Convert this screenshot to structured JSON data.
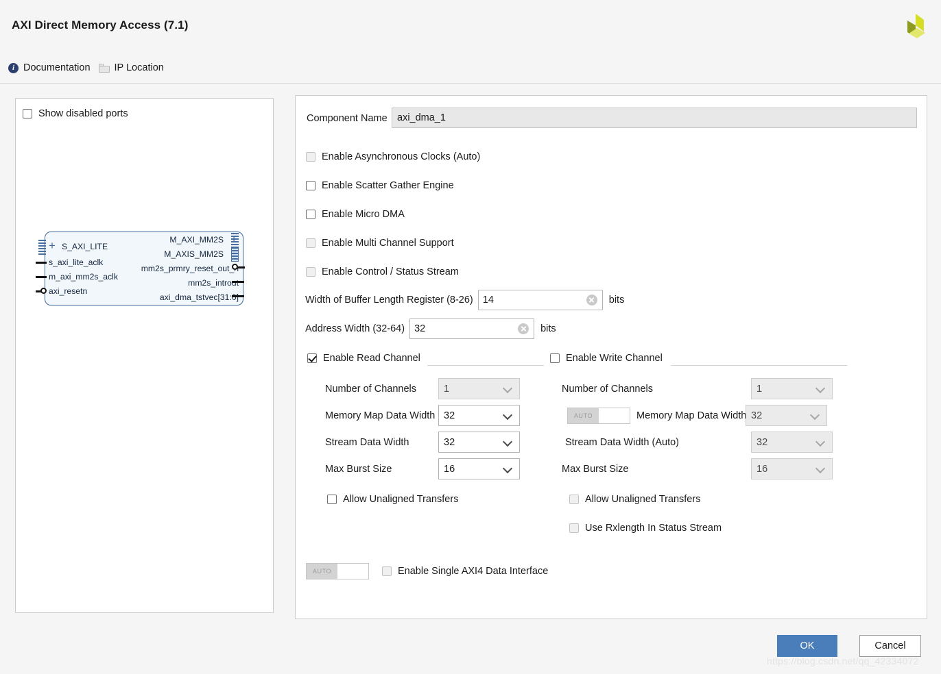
{
  "header": {
    "title": "AXI Direct Memory Access (7.1)",
    "links": [
      {
        "icon": "info-icon",
        "label": "Documentation"
      },
      {
        "icon": "folder-icon",
        "label": "IP Location"
      }
    ],
    "logo_name": "xilinx-logo"
  },
  "left_panel": {
    "show_disabled_ports": {
      "label": "Show disabled ports",
      "checked": false
    }
  },
  "diagram": {
    "left_ports": [
      "S_AXI_LITE",
      "s_axi_lite_aclk",
      "m_axi_mm2s_aclk",
      "axi_resetn"
    ],
    "right_ports": [
      "M_AXI_MM2S",
      "M_AXIS_MM2S",
      "mm2s_prmry_reset_out_n",
      "mm2s_introut",
      "axi_dma_tstvec[31:0]"
    ]
  },
  "form": {
    "component_name_label": "Component Name",
    "component_name_value": "axi_dma_1",
    "checkboxes": [
      {
        "label": "Enable Asynchronous Clocks (Auto)",
        "checked": false,
        "disabled": true
      },
      {
        "label": "Enable Scatter Gather Engine",
        "checked": false,
        "disabled": false
      },
      {
        "label": "Enable Micro DMA",
        "checked": false,
        "disabled": false
      },
      {
        "label": "Enable Multi Channel Support",
        "checked": false,
        "disabled": true
      },
      {
        "label": "Enable Control / Status Stream",
        "checked": false,
        "disabled": true
      }
    ],
    "buffer_length": {
      "label": "Width of Buffer Length Register (8-26)",
      "value": "14",
      "unit": "bits"
    },
    "address_width": {
      "label": "Address Width (32-64)",
      "value": "32",
      "unit": "bits"
    },
    "read_channel": {
      "title": "Enable Read Channel",
      "checked": true,
      "fields": [
        {
          "label": "Number of Channels",
          "value": "1",
          "disabled": true
        },
        {
          "label": "Memory Map Data Width",
          "value": "32",
          "disabled": false
        },
        {
          "label": "Stream Data Width",
          "value": "32",
          "disabled": false
        },
        {
          "label": "Max Burst Size",
          "value": "16",
          "disabled": false
        }
      ],
      "allow_unaligned": {
        "label": "Allow Unaligned Transfers",
        "checked": false,
        "disabled": false
      }
    },
    "write_channel": {
      "title": "Enable Write Channel",
      "checked": false,
      "fields": [
        {
          "label": "Number of Channels",
          "value": "1",
          "disabled": true
        },
        {
          "label": "Memory Map Data Width",
          "value": "32",
          "disabled": true
        },
        {
          "label": "Stream Data Width (Auto)",
          "value": "32",
          "disabled": true
        },
        {
          "label": "Max Burst Size",
          "value": "16",
          "disabled": true
        }
      ],
      "auto_toggle_label": "AUTO",
      "allow_unaligned": {
        "label": "Allow Unaligned Transfers",
        "checked": false,
        "disabled": true
      },
      "use_rxlength": {
        "label": "Use Rxlength In Status Stream",
        "checked": false,
        "disabled": true
      }
    },
    "single_axi4": {
      "auto_toggle_label": "AUTO",
      "label": "Enable Single AXI4 Data Interface",
      "checked": false,
      "disabled": true
    }
  },
  "footer": {
    "ok_label": "OK",
    "cancel_label": "Cancel",
    "watermark": "https://blog.csdn.net/qq_42334072"
  },
  "colors": {
    "accent": "#4a7ebb",
    "block_border": "#41699c",
    "block_fill": "#f2f7fb",
    "window_bg": "#f5f5f5"
  }
}
